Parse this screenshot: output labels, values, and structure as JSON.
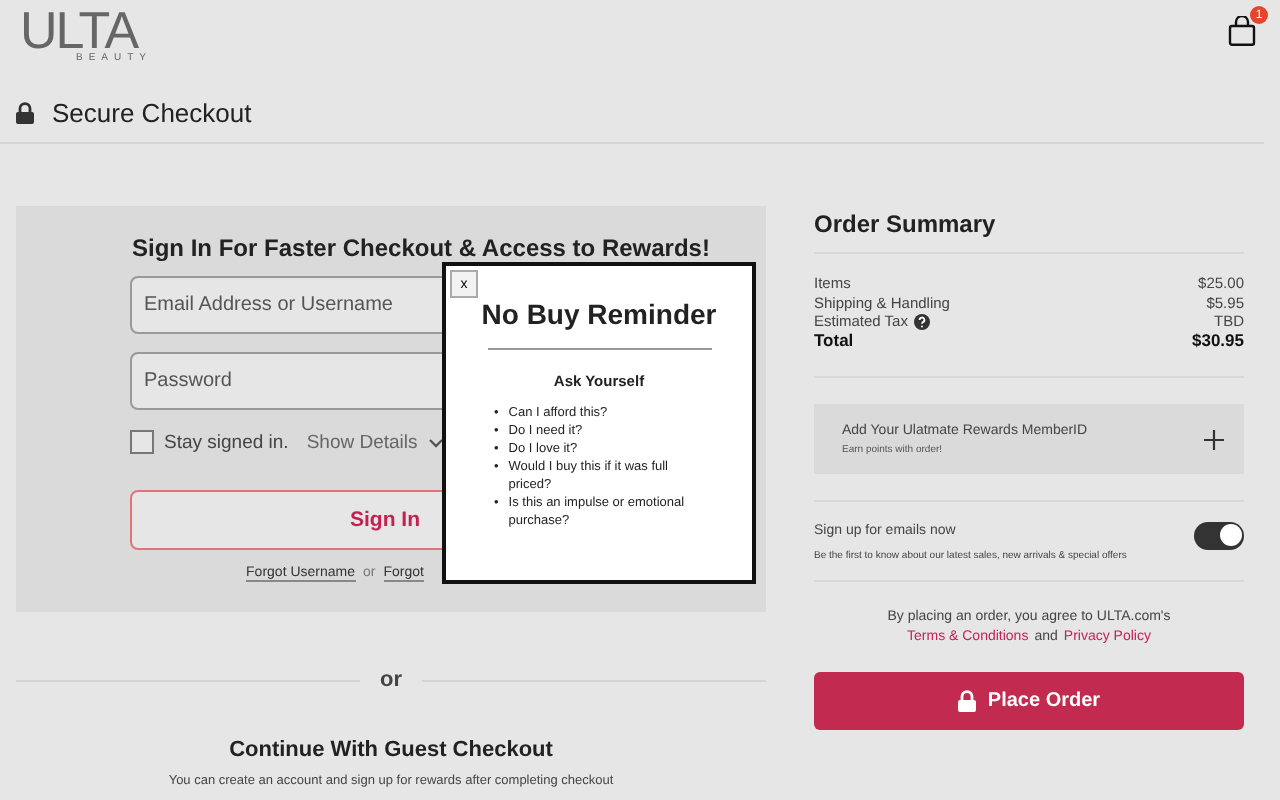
{
  "header": {
    "logo": "ULTA",
    "logo_sub": "BEAUTY",
    "cart_count": "1",
    "secure_title": "Secure Checkout"
  },
  "sign_in": {
    "heading": "Sign In For Faster Checkout & Access to Rewards!",
    "email_placeholder": "Email Address or Username",
    "password_placeholder": "Password",
    "stay_signed_in": {
      "label": "Stay signed in.",
      "checked": false
    },
    "show_details": "Show Details",
    "button": "Sign In",
    "forgot_username": "Forgot Username",
    "or_text": "or",
    "forgot_other": "Forgot"
  },
  "divider_text": "or",
  "guest": {
    "heading": "Continue With Guest Checkout",
    "text": "You can create an account and sign up for rewards after completing checkout"
  },
  "order_summary": {
    "title": "Order Summary",
    "rows": [
      {
        "label": "Items",
        "value": "$25.00",
        "kind": "plain"
      },
      {
        "label": "Shipping & Handling",
        "value": "$5.95",
        "kind": "plain"
      },
      {
        "label": "Estimated Tax",
        "value": "TBD",
        "kind": "info"
      },
      {
        "label": "Total",
        "value": "$30.95",
        "kind": "total"
      }
    ]
  },
  "rewards": {
    "title": "Add Your Ulatmate Rewards MemberID",
    "subtitle": "Earn points with order!"
  },
  "emails": {
    "title": "Sign up for emails now",
    "subtitle": "Be the first to know about our latest sales, new arrivals & special offers",
    "on": true
  },
  "terms": {
    "text": "By placing an order, you agree to ULTA.com's",
    "terms_link": "Terms & Conditions",
    "and": "and",
    "privacy_link": "Privacy Policy"
  },
  "place_order": "Place Order",
  "modal": {
    "close": "x",
    "title": "No Buy Reminder",
    "subtitle": "Ask Yourself",
    "bullet": "•",
    "items": [
      "Can I afford this?",
      "Do I need it?",
      "Do I love it?",
      "Would I buy this if it was full priced?",
      "Is this an impulse or emotional purchase?"
    ]
  }
}
